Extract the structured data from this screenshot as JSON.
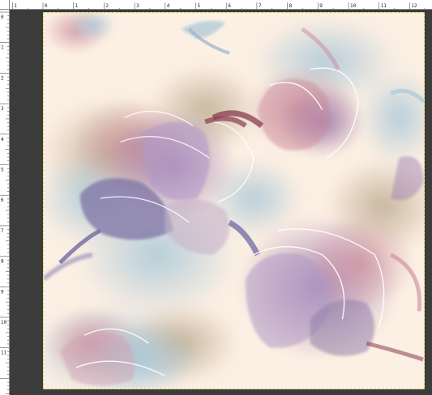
{
  "ruler": {
    "top_labels": [
      "1",
      "0",
      "1",
      "2",
      "3",
      "4",
      "5",
      "6",
      "7",
      "8",
      "9",
      "10",
      "11",
      "12"
    ],
    "left_labels": [
      "0",
      "1",
      "2",
      "3",
      "4",
      "5",
      "6",
      "7",
      "8",
      "9",
      "10",
      "11"
    ]
  },
  "document": {
    "content": "watercolor floral pattern",
    "colors": {
      "background": "#fcefe3",
      "mauve": "#9c7bb0",
      "dusty_pink": "#c98a9a",
      "wine": "#8a3b52",
      "slate_blue": "#7f8fb0",
      "pale_blue": "#a9c7d8",
      "khaki": "#b7a68a",
      "selection_border": "#d9d04a"
    }
  }
}
